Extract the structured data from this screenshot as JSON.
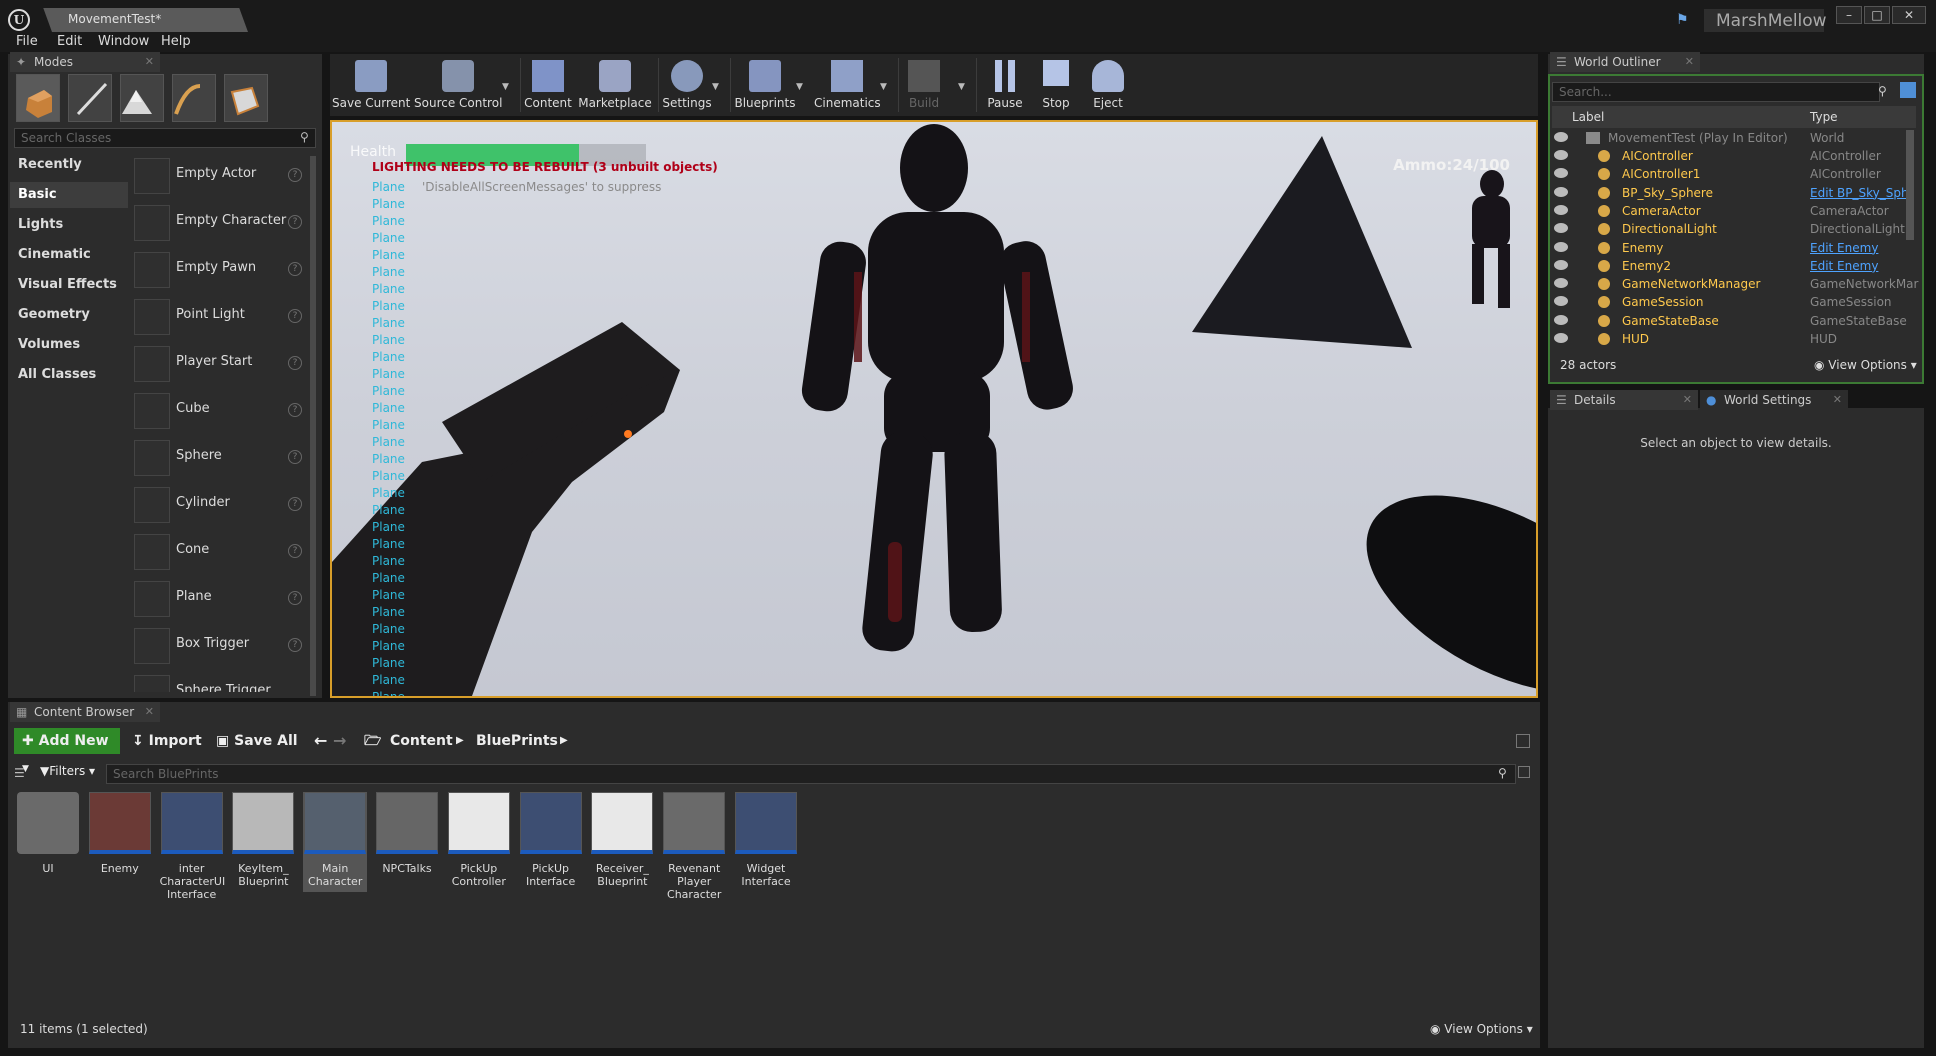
{
  "window": {
    "document_tab": "MovementTest*",
    "user_name": "MarshMellow",
    "minimize": "–",
    "maximize": "□",
    "close": "✕"
  },
  "menu": [
    "File",
    "Edit",
    "Window",
    "Help"
  ],
  "modes_panel": {
    "tab": "Modes",
    "search_placeholder": "Search Classes",
    "categories": [
      "Recently Placed",
      "Basic",
      "Lights",
      "Cinematic",
      "Visual Effects",
      "Geometry",
      "Volumes",
      "All Classes"
    ],
    "selected_category": "Basic",
    "items": [
      "Empty Actor",
      "Empty Character",
      "Empty Pawn",
      "Point Light",
      "Player Start",
      "Cube",
      "Sphere",
      "Cylinder",
      "Cone",
      "Plane",
      "Box Trigger",
      "Sphere Trigger"
    ]
  },
  "toolbar": [
    "Save Current",
    "Source Control",
    "Content",
    "Marketplace",
    "Settings",
    "Blueprints",
    "Cinematics",
    "Build",
    "Pause",
    "Stop",
    "Eject"
  ],
  "viewport": {
    "health_label": "Health",
    "health_fraction": 0.72,
    "lighting_warning": "LIGHTING NEEDS TO BE REBUILT (3 unbuilt objects)",
    "suppress_hint": "'DisableAllScreenMessages' to suppress",
    "ammo": "Ammo:24/100",
    "plane_message": "Plane",
    "plane_message_count": 31
  },
  "outliner": {
    "tab": "World Outliner",
    "search_placeholder": "Search...",
    "col_label": "Label",
    "col_type": "Type",
    "root": {
      "label": "MovementTest (Play In Editor)",
      "type": "World"
    },
    "rows": [
      {
        "label": "AIController",
        "type": "AIController",
        "link": false
      },
      {
        "label": "AIController1",
        "type": "AIController",
        "link": false
      },
      {
        "label": "BP_Sky_Sphere",
        "type": "Edit BP_Sky_Sph",
        "link": true
      },
      {
        "label": "CameraActor",
        "type": "CameraActor",
        "link": false
      },
      {
        "label": "DirectionalLight",
        "type": "DirectionalLight",
        "link": false
      },
      {
        "label": "Enemy",
        "type": "Edit Enemy",
        "link": true
      },
      {
        "label": "Enemy2",
        "type": "Edit Enemy",
        "link": true
      },
      {
        "label": "GameNetworkManager",
        "type": "GameNetworkMar",
        "link": false
      },
      {
        "label": "GameSession",
        "type": "GameSession",
        "link": false
      },
      {
        "label": "GameStateBase",
        "type": "GameStateBase",
        "link": false
      },
      {
        "label": "HUD",
        "type": "HUD",
        "link": false
      }
    ],
    "actor_count": "28 actors",
    "view_options": "View Options"
  },
  "details": {
    "tab": "Details",
    "tab2": "World Settings",
    "empty_message": "Select an object to view details."
  },
  "content_browser": {
    "tab": "Content Browser",
    "add_new": "Add New",
    "import": "Import",
    "save_all": "Save All",
    "path": [
      "Content",
      "BluePrints"
    ],
    "filters": "Filters",
    "search_placeholder": "Search BluePrints",
    "assets": [
      "UI",
      "Enemy",
      "inter CharacterUI Interface",
      "KeyItem_ Blueprint",
      "Main Character",
      "NPCTalks",
      "PickUp Controller",
      "PickUp Interface",
      "Receiver_ Blueprint",
      "Revenant Player Character",
      "Widget Interface"
    ],
    "selected_asset": "Main Character",
    "status": "11 items (1 selected)",
    "view_options": "View Options"
  }
}
